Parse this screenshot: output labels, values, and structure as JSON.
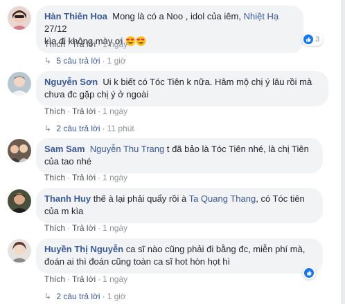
{
  "comments": [
    {
      "author": "Hàn Thiên Hoa",
      "text_before": "Mong là có a Noo , idol của iêm, ",
      "tag": "Nhiệt Hạ",
      "text_after": " 27/12",
      "line2": "kìa đi không mày ơi",
      "like_label": "Thích",
      "reply_label": "Trả lời",
      "time": "1 ngày",
      "reaction_count": "3",
      "replies_label": "5 câu trả lời",
      "replies_time": "1 giờ"
    },
    {
      "author": "Nguyễn Sơn",
      "text": "Ui k biết có Tóc Tiên k nữa. Hâm mộ chị ý lâu rồi mà",
      "line2": "chưa đc gặp chị ý ở ngoài",
      "like_label": "Thích",
      "reply_label": "Trả lời",
      "time": "1 ngày",
      "replies_label": "2 câu trả lời",
      "replies_time": "11 phút"
    },
    {
      "author": "Sam Sam",
      "tag": "Nguyễn Thu Trang",
      "text": " t đã bảo là Tóc Tiên nhé, là chị Tiên",
      "line2": "của tao nhé",
      "like_label": "Thích",
      "reply_label": "Trả lời",
      "time": "1 ngày"
    },
    {
      "author": "Thanh Huy",
      "text": " thế à lại phải quẩy rồi à ",
      "tag": "Ta Quang Thang",
      "text_after": ", có Tóc tiên",
      "line2": "của m kìa",
      "like_label": "Thích",
      "reply_label": "Trả lời",
      "time": "1 ngày"
    },
    {
      "author": "Huyền Thị Nguyễn",
      "text": " ca sĩ nào cũng phải đi bằng đc, miễn phí mà,",
      "line2": "đoán ai thì đoán cũng toàn ca sĩ hot hòn họt hì",
      "like_label": "Thích",
      "reply_label": "Trả lời",
      "time": "1 ngày",
      "replies_label": "2 câu trả lời",
      "replies_time": "1 giờ"
    }
  ],
  "colors": {
    "name": "#385898",
    "bubble": "#f2f3f5",
    "like": "#1877f2",
    "meta": "#90949c"
  }
}
